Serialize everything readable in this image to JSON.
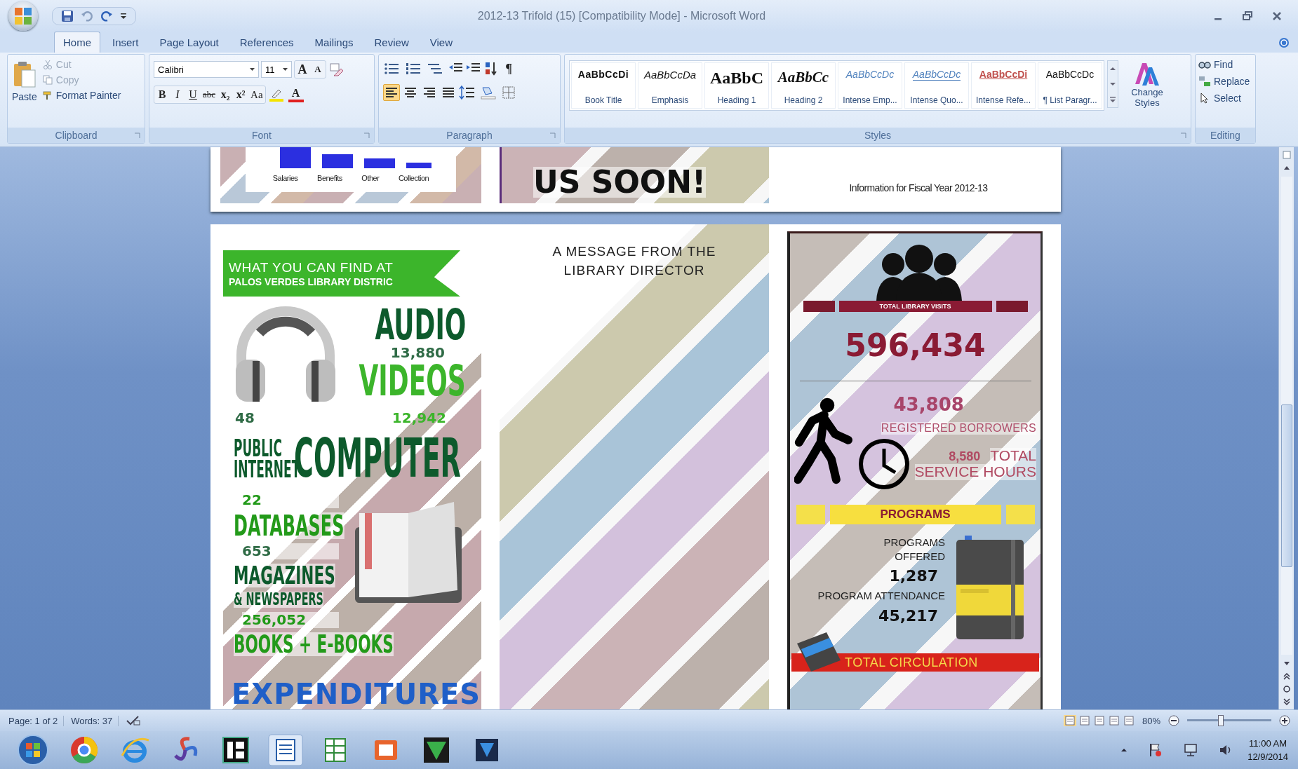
{
  "window": {
    "title": "2012-13 Trifold (15) [Compatibility Mode] - Microsoft Word"
  },
  "ribbon_tabs": [
    {
      "label": "Home",
      "selected": true
    },
    {
      "label": "Insert",
      "selected": false
    },
    {
      "label": "Page Layout",
      "selected": false
    },
    {
      "label": "References",
      "selected": false
    },
    {
      "label": "Mailings",
      "selected": false
    },
    {
      "label": "Review",
      "selected": false
    },
    {
      "label": "View",
      "selected": false
    }
  ],
  "clipboard": {
    "group": "Clipboard",
    "paste": "Paste",
    "actions": [
      {
        "kind": "cut",
        "label": "Cut",
        "disabled": true
      },
      {
        "kind": "copy",
        "label": "Copy",
        "disabled": true
      },
      {
        "kind": "format-painter",
        "label": "Format Painter",
        "disabled": false
      }
    ]
  },
  "font": {
    "group": "Font",
    "name": "Calibri",
    "size": "11",
    "size_buttons": [
      {
        "kind": "grow",
        "label": "A"
      },
      {
        "kind": "shrink",
        "label": "A"
      }
    ],
    "buttons": [
      {
        "kind": "bold",
        "label": "B"
      },
      {
        "kind": "italic",
        "label": "I"
      },
      {
        "kind": "underline",
        "label": "U"
      },
      {
        "kind": "strike",
        "label": "abc"
      },
      {
        "kind": "subscript",
        "label": "x₂"
      },
      {
        "kind": "superscript",
        "label": "x²"
      },
      {
        "kind": "case",
        "label": "Aa"
      }
    ],
    "color_label": "A"
  },
  "paragraph": {
    "group": "Paragraph",
    "show_marks": "¶",
    "alignments": [
      {
        "kind": "left",
        "selected": true
      },
      {
        "kind": "center",
        "selected": false
      },
      {
        "kind": "right",
        "selected": false
      },
      {
        "kind": "justify",
        "selected": false
      }
    ]
  },
  "styles": {
    "group": "Styles",
    "change_styles": "Change Styles",
    "items": [
      {
        "kind": "book-title",
        "preview": "AaBbCcDi",
        "name": "Book Title"
      },
      {
        "kind": "emphasis",
        "preview": "AaBbCcDa",
        "name": "Emphasis"
      },
      {
        "kind": "heading-1",
        "preview": "AaBbC",
        "name": "Heading 1"
      },
      {
        "kind": "heading-2",
        "preview": "AaBbCc",
        "name": "Heading 2"
      },
      {
        "kind": "intense-emphasis",
        "preview": "AaBbCcDc",
        "name": "Intense Emp..."
      },
      {
        "kind": "intense-quote",
        "preview": "AaBbCcDc",
        "name": "Intense Quo..."
      },
      {
        "kind": "intense-reference",
        "preview": "AaBbCcDi",
        "name": "Intense Refe..."
      },
      {
        "kind": "list-paragraph",
        "preview": "AaBbCcDc",
        "name": "¶ List Paragr..."
      }
    ]
  },
  "editing": {
    "group": "Editing",
    "actions": [
      {
        "kind": "find",
        "label": "Find"
      },
      {
        "kind": "replace",
        "label": "Replace"
      },
      {
        "kind": "select",
        "label": "Select"
      }
    ]
  },
  "document": {
    "page_1": {
      "chart_labels": [
        "Salaries",
        "Benefits",
        "Other",
        "Collection"
      ],
      "heading": "US SOON!",
      "caption": "Information for Fiscal Year 2012-13"
    },
    "page_2": {
      "banner": [
        "WHAT YOU CAN FIND AT",
        "PALOS VERDES LIBRARY DISTRIC"
      ],
      "audio": {
        "label": "AUDIO",
        "value": "13,880"
      },
      "videos": {
        "label": "VIDEOS",
        "value": "12,942"
      },
      "computers": {
        "value": "48",
        "prefix": [
          "PUBLIC",
          "INTERNET"
        ],
        "label": "COMPUTER"
      },
      "databases": {
        "value": "22",
        "label": "DATABASES"
      },
      "magazines": {
        "value": "653",
        "label": "MAGAZINES",
        "sublabel": "& NEWSPAPERS"
      },
      "books": {
        "value": "256,052",
        "label": "BOOKS + E-BOOKS"
      },
      "expenditures": "EXPENDITURES",
      "message_heading": "A MESSAGE FROM THE LIBRARY DIRECTOR",
      "visits": {
        "label": "TOTAL LIBRARY VISITS",
        "value": "596,434"
      },
      "borrowers": {
        "value": "43,808",
        "label": "REGISTERED BORROWERS"
      },
      "hours": {
        "value": "8,580",
        "label_1": "TOTAL",
        "label_2": "SERVICE HOURS"
      },
      "programs": {
        "banner": "PROGRAMS",
        "offered_label": "PROGRAMS OFFERED",
        "offered_value": "1,287",
        "attendance_label": "PROGRAM ATTENDANCE",
        "attendance_value": "45,217"
      },
      "circulation": "TOTAL CIRCULATION"
    }
  },
  "status_bar": {
    "page": "Page: 1 of 2",
    "words": "Words: 37",
    "zoom": "80%",
    "zoom_slider": {
      "level": 0.4
    }
  },
  "taskbar": {
    "time": "11:00 AM",
    "date": "12/9/2014"
  }
}
